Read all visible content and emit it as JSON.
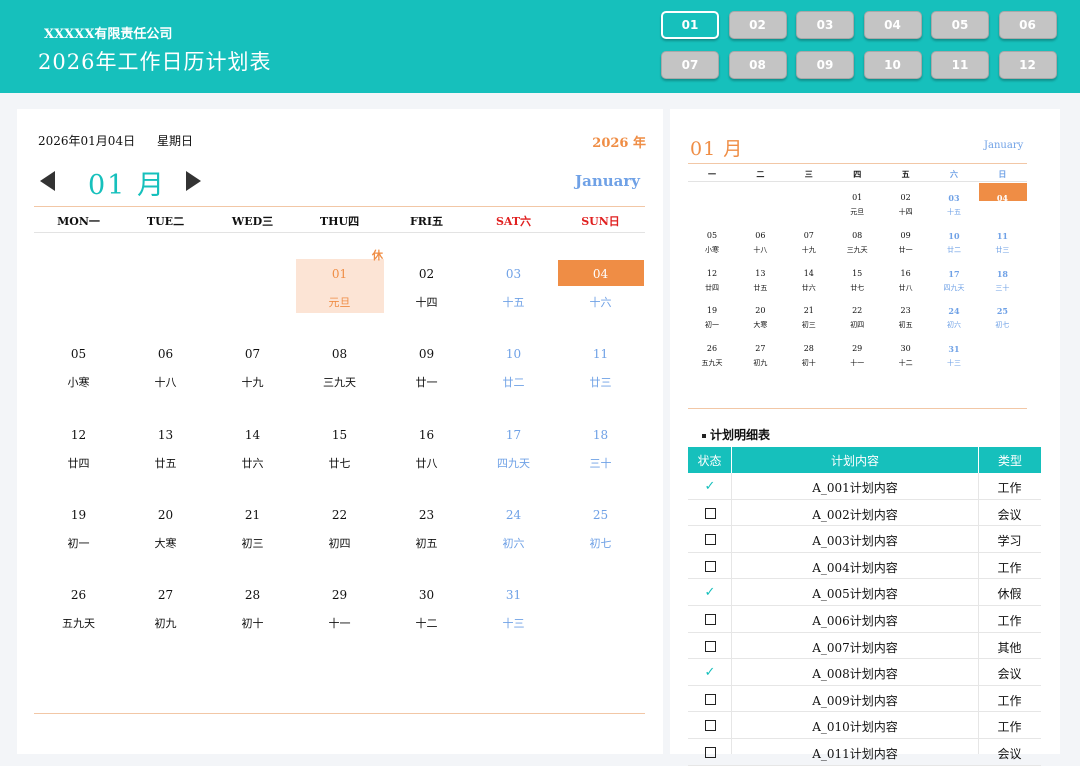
{
  "header": {
    "company": "XXXXX有限责任公司",
    "title": "2026年工作日历计划表",
    "months": [
      "01",
      "02",
      "03",
      "04",
      "05",
      "06",
      "07",
      "08",
      "09",
      "10",
      "11",
      "12"
    ],
    "active_month_index": 0
  },
  "main": {
    "date_text": "2026年01月04日",
    "weekday_text": "星期日",
    "year_text": "2026 年",
    "month_text": "01 月",
    "month_en": "January",
    "weekdays": [
      "MON一",
      "TUE二",
      "WED三",
      "THU四",
      "FRI五",
      "SAT六",
      "SUN日"
    ],
    "rest_badge": "休",
    "weeks": [
      [
        null,
        null,
        null,
        {
          "d": "01",
          "l": "元旦"
        },
        {
          "d": "02",
          "l": "十四"
        },
        {
          "d": "03",
          "l": "十五"
        },
        {
          "d": "04",
          "l": "十六"
        }
      ],
      [
        {
          "d": "05",
          "l": "小寒"
        },
        {
          "d": "06",
          "l": "十八"
        },
        {
          "d": "07",
          "l": "十九"
        },
        {
          "d": "08",
          "l": "三九天"
        },
        {
          "d": "09",
          "l": "廿一"
        },
        {
          "d": "10",
          "l": "廿二"
        },
        {
          "d": "11",
          "l": "廿三"
        }
      ],
      [
        {
          "d": "12",
          "l": "廿四"
        },
        {
          "d": "13",
          "l": "廿五"
        },
        {
          "d": "14",
          "l": "廿六"
        },
        {
          "d": "15",
          "l": "廿七"
        },
        {
          "d": "16",
          "l": "廿八"
        },
        {
          "d": "17",
          "l": "四九天"
        },
        {
          "d": "18",
          "l": "三十"
        }
      ],
      [
        {
          "d": "19",
          "l": "初一"
        },
        {
          "d": "20",
          "l": "大寒"
        },
        {
          "d": "21",
          "l": "初三"
        },
        {
          "d": "22",
          "l": "初四"
        },
        {
          "d": "23",
          "l": "初五"
        },
        {
          "d": "24",
          "l": "初六"
        },
        {
          "d": "25",
          "l": "初七"
        }
      ],
      [
        {
          "d": "26",
          "l": "五九天"
        },
        {
          "d": "27",
          "l": "初九"
        },
        {
          "d": "28",
          "l": "初十"
        },
        {
          "d": "29",
          "l": "十一"
        },
        {
          "d": "30",
          "l": "十二"
        },
        {
          "d": "31",
          "l": "十三"
        },
        null
      ]
    ]
  },
  "mini": {
    "month_text": "01 月",
    "month_en": "January",
    "weekdays": [
      "一",
      "二",
      "三",
      "四",
      "五",
      "六",
      "日"
    ],
    "weeks": [
      [
        null,
        null,
        null,
        {
          "d": "01",
          "l": "元旦"
        },
        {
          "d": "02",
          "l": "十四"
        },
        {
          "d": "03",
          "l": "十五"
        },
        {
          "d": "04",
          "l": "十六"
        }
      ],
      [
        {
          "d": "05",
          "l": "小寒"
        },
        {
          "d": "06",
          "l": "十八"
        },
        {
          "d": "07",
          "l": "十九"
        },
        {
          "d": "08",
          "l": "三九天"
        },
        {
          "d": "09",
          "l": "廿一"
        },
        {
          "d": "10",
          "l": "廿二"
        },
        {
          "d": "11",
          "l": "廿三"
        }
      ],
      [
        {
          "d": "12",
          "l": "廿四"
        },
        {
          "d": "13",
          "l": "廿五"
        },
        {
          "d": "14",
          "l": "廿六"
        },
        {
          "d": "15",
          "l": "廿七"
        },
        {
          "d": "16",
          "l": "廿八"
        },
        {
          "d": "17",
          "l": "四九天"
        },
        {
          "d": "18",
          "l": "三十"
        }
      ],
      [
        {
          "d": "19",
          "l": "初一"
        },
        {
          "d": "20",
          "l": "大寒"
        },
        {
          "d": "21",
          "l": "初三"
        },
        {
          "d": "22",
          "l": "初四"
        },
        {
          "d": "23",
          "l": "初五"
        },
        {
          "d": "24",
          "l": "初六"
        },
        {
          "d": "25",
          "l": "初七"
        }
      ],
      [
        {
          "d": "26",
          "l": "五九天"
        },
        {
          "d": "27",
          "l": "初九"
        },
        {
          "d": "28",
          "l": "初十"
        },
        {
          "d": "29",
          "l": "十一"
        },
        {
          "d": "30",
          "l": "十二"
        },
        {
          "d": "31",
          "l": "十三"
        },
        null
      ]
    ]
  },
  "plan": {
    "title": "计划明细表",
    "headers": [
      "状态",
      "计划内容",
      "类型"
    ],
    "rows": [
      {
        "done": true,
        "content": "A_001计划内容",
        "type": "工作"
      },
      {
        "done": false,
        "content": "A_002计划内容",
        "type": "会议"
      },
      {
        "done": false,
        "content": "A_003计划内容",
        "type": "学习"
      },
      {
        "done": false,
        "content": "A_004计划内容",
        "type": "工作"
      },
      {
        "done": true,
        "content": "A_005计划内容",
        "type": "休假"
      },
      {
        "done": false,
        "content": "A_006计划内容",
        "type": "工作"
      },
      {
        "done": false,
        "content": "A_007计划内容",
        "type": "其他"
      },
      {
        "done": true,
        "content": "A_008计划内容",
        "type": "会议"
      },
      {
        "done": false,
        "content": "A_009计划内容",
        "type": "工作"
      },
      {
        "done": false,
        "content": "A_010计划内容",
        "type": "工作"
      },
      {
        "done": false,
        "content": "A_011计划内容",
        "type": "会议"
      }
    ]
  },
  "colors": {
    "teal": "#16c0bc",
    "orange": "#ef8d45",
    "weekend_blue": "#6fa1e6",
    "weekend_header_red": "#e02020"
  }
}
